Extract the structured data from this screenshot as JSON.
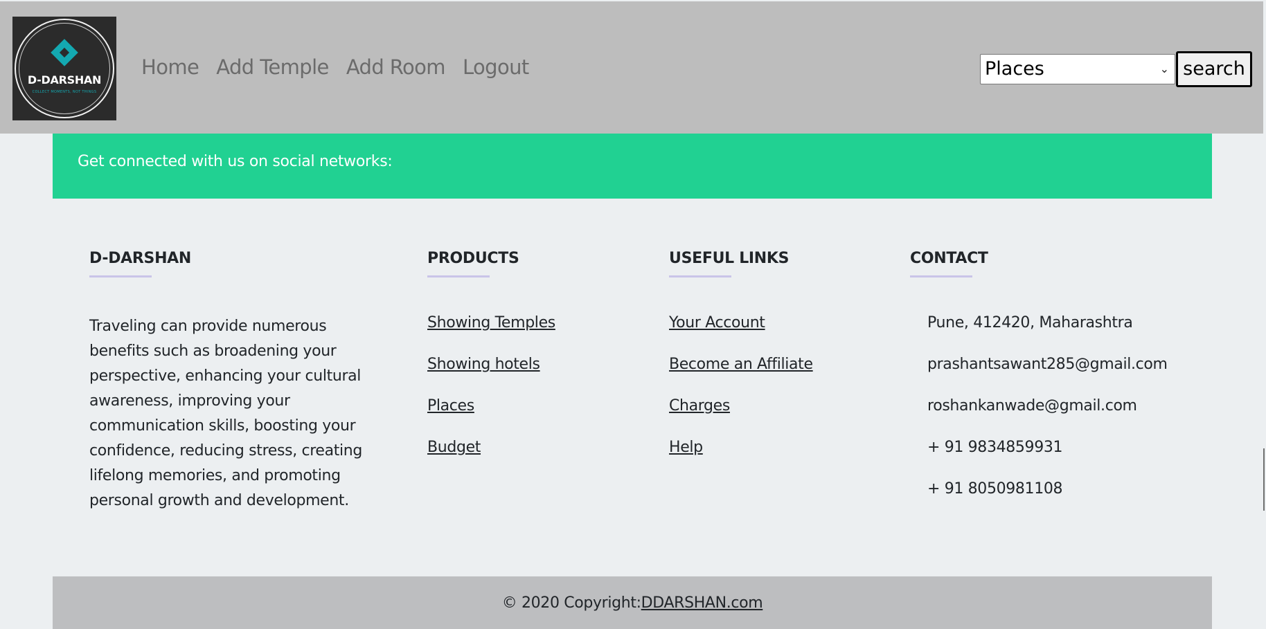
{
  "navbar": {
    "logo": {
      "title": "D-DARSHAN",
      "tagline": "COLLECT MOMENTS, NOT THINGS"
    },
    "links": [
      "Home",
      "Add Temple",
      "Add Room",
      "Logout"
    ],
    "search": {
      "selected": "Places",
      "button_label": "search"
    }
  },
  "social": {
    "text": "Get connected with us on social networks:"
  },
  "footer": {
    "about": {
      "title": "D-DARSHAN",
      "text": "Traveling can provide numerous benefits such as broadening your perspective, enhancing your cultural awareness, improving your communication skills, boosting your confidence, reducing stress, creating lifelong memories, and promoting personal growth and development."
    },
    "products": {
      "title": "PRODUCTS",
      "links": [
        "Showing Temples",
        "Showing hotels",
        "Places",
        "Budget"
      ]
    },
    "useful_links": {
      "title": "USEFUL LINKS",
      "links": [
        "Your Account",
        "Become an Affiliate",
        "Charges",
        "Help"
      ]
    },
    "contact": {
      "title": "CONTACT",
      "items": [
        "Pune, 412420, Maharashtra",
        "prashantsawant285@gmail.com",
        "roshankanwade@gmail.com",
        "+ 91 9834859931",
        "+ 91 8050981108"
      ]
    }
  },
  "copyright": {
    "text": "© 2020 Copyright:",
    "link": "DDARSHAN.com"
  },
  "colors": {
    "navbar_bg": "#BDBDBD",
    "social_bg": "#21D192",
    "footer_bg": "#ECEFF1",
    "copyright_bg": "#BDBEC0",
    "logo_accent": "#14A9B1"
  }
}
